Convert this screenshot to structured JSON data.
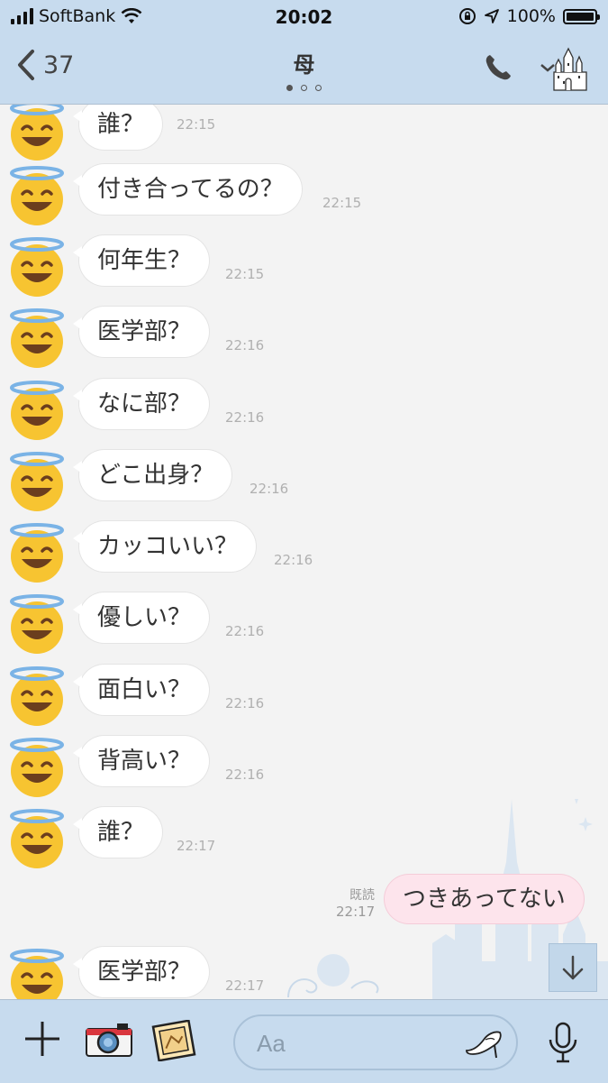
{
  "status_bar": {
    "carrier": "SoftBank",
    "time": "20:02",
    "battery": "100%"
  },
  "header": {
    "back_count": "37",
    "title": "母"
  },
  "messages": [
    {
      "text": "誰？",
      "time": "22:15"
    },
    {
      "text": "付き合ってるの？",
      "time": "22:15"
    },
    {
      "text": "何年生？",
      "time": "22:15"
    },
    {
      "text": "医学部？",
      "time": "22:16"
    },
    {
      "text": "なに部？",
      "time": "22:16"
    },
    {
      "text": "どこ出身？",
      "time": "22:16"
    },
    {
      "text": "カッコいい？",
      "time": "22:16"
    },
    {
      "text": "優しい？",
      "time": "22:16"
    },
    {
      "text": "面白い？",
      "time": "22:16"
    },
    {
      "text": "背高い？",
      "time": "22:16"
    },
    {
      "text": "誰？",
      "time": "22:17"
    },
    {
      "text": "医学部？",
      "time": "22:17"
    }
  ],
  "outgoing": {
    "text": "つきあってない",
    "read_label": "既読",
    "time": "22:17"
  },
  "input": {
    "placeholder": "Aa"
  },
  "icons": {
    "avatar": "smiling-face-with-halo-icon",
    "back": "chevron-left-icon",
    "phone": "phone-icon",
    "menu": "chevron-down-castle-icon",
    "scroll_down": "arrow-down-icon",
    "plus": "plus-icon",
    "camera": "camera-icon",
    "photo": "photo-icon",
    "sticker": "glass-slipper-icon",
    "mic": "microphone-icon"
  },
  "colors": {
    "header_bg": "#c7dbee",
    "chat_bg": "#f3f3f3",
    "outgoing_bubble": "#fde4ec",
    "incoming_bubble": "#ffffff"
  }
}
